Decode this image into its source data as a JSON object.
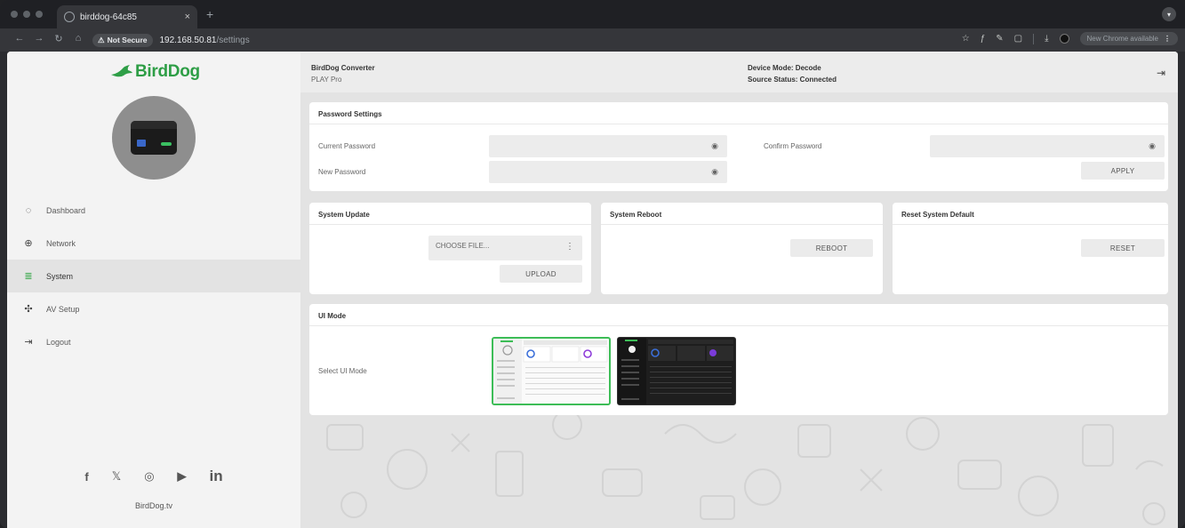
{
  "browser": {
    "tab_title": "birddog-64c85",
    "tab_close": "×",
    "new_tab": "+",
    "not_secure": "Not Secure",
    "url_host": "192.168.50.81",
    "url_path": "/settings",
    "update_text": "New Chrome available"
  },
  "brand": {
    "logo_text": "BirdDog",
    "logo_color": "#2e9e46",
    "website": "BirdDog.tv"
  },
  "sidebar": {
    "items": [
      {
        "label": "Dashboard",
        "icon": "dashboard-icon"
      },
      {
        "label": "Network",
        "icon": "globe-icon"
      },
      {
        "label": "System",
        "icon": "database-icon"
      },
      {
        "label": "AV Setup",
        "icon": "av-setup-icon"
      },
      {
        "label": "Logout",
        "icon": "logout-icon"
      }
    ],
    "active_index": 2,
    "socials": [
      "facebook-icon",
      "x-icon",
      "instagram-icon",
      "youtube-icon",
      "linkedin-icon"
    ]
  },
  "header": {
    "product": "BirdDog Converter",
    "model": "PLAY Pro",
    "device_mode": "Device Mode: Decode",
    "source_status": "Source Status: Connected"
  },
  "password": {
    "title": "Password Settings",
    "current_label": "Current Password",
    "new_label": "New Password",
    "confirm_label": "Confirm Password",
    "apply": "APPLY"
  },
  "update": {
    "title": "System Update",
    "choose_file": "CHOOSE FILE...",
    "upload": "UPLOAD"
  },
  "reboot": {
    "title": "System Reboot",
    "button": "REBOOT"
  },
  "reset": {
    "title": "Reset System Default",
    "button": "RESET"
  },
  "uimode": {
    "title": "UI Mode",
    "label": "Select UI Mode",
    "selected": "light",
    "accent": "#3dbd57"
  }
}
